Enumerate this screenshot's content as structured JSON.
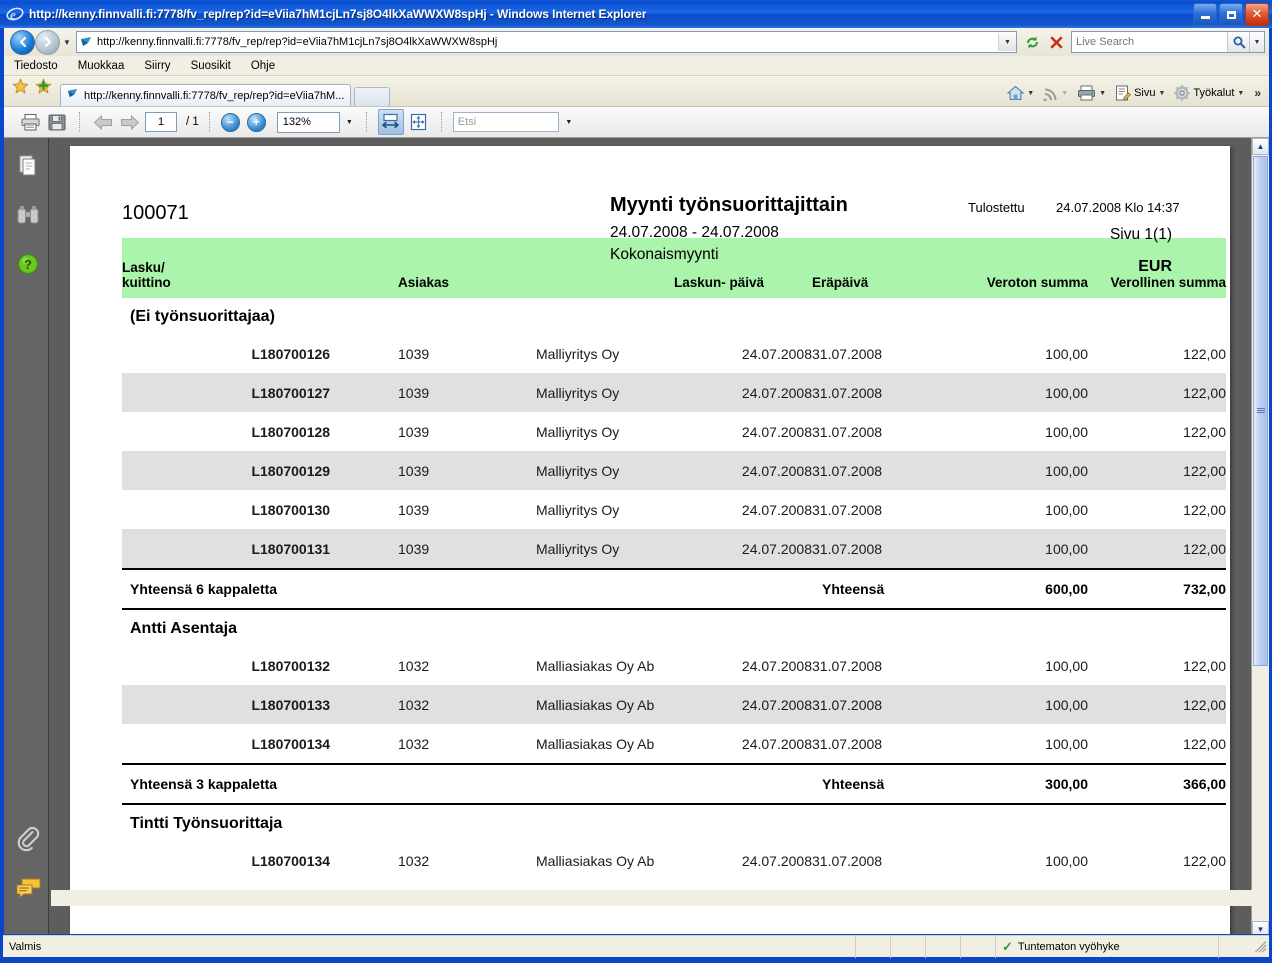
{
  "window": {
    "title": "http://kenny.finnvalli.fi:7778/fv_rep/rep?id=eViia7hM1cjLn7sj8O4lkXaWWXW8spHj - Windows Internet Explorer",
    "minimize_label": "Minimize",
    "maximize_label": "Maximize",
    "close_label": "✕"
  },
  "browser": {
    "address_value": "http://kenny.finnvalli.fi:7778/fv_rep/rep?id=eViia7hM1cjLn7sj8O4lkXaWWXW8spHj",
    "search_placeholder": "Live Search",
    "back_glyph": "◀",
    "forward_glyph": "▶",
    "history_caret": "▼",
    "address_caret": "▼",
    "refresh_glyph": "↻",
    "stop_glyph": "✕",
    "search_go_glyph": "⌕",
    "search_caret": "▼",
    "menu": [
      "Tiedosto",
      "Muokkaa",
      "Siirry",
      "Suosikit",
      "Ohje"
    ],
    "tab_label": "http://kenny.finnvalli.fi:7778/fv_rep/rep?id=eViia7hM...",
    "commands": {
      "home": "Home",
      "feeds": "Feeds",
      "print": "Print",
      "page": "Sivu",
      "tools": "Työkalut",
      "overflow": "»",
      "caret": "▼"
    }
  },
  "pdf_toolbar": {
    "print_label": "Print",
    "save_label": "Save",
    "prev_label": "Previous page",
    "next_label": "Next page",
    "page_value": "1",
    "page_total": "/ 1",
    "zoom_out": "−",
    "zoom_in": "+",
    "zoom_value": "132%",
    "zoom_caret": "▼",
    "fit_width_label": "Fit width",
    "fit_page_label": "Fit page",
    "find_placeholder": "Etsi",
    "find_caret": "▼"
  },
  "sidebar": {
    "icons": [
      {
        "name": "pages-icon",
        "label": "Pages"
      },
      {
        "name": "binoculars-icon",
        "label": "Search"
      },
      {
        "name": "help-icon",
        "label": "Help"
      },
      {
        "name": "attachment-icon",
        "label": "Attachments"
      },
      {
        "name": "comments-icon",
        "label": "Comments"
      }
    ]
  },
  "report": {
    "id": "100071",
    "title": "Myynti työnsuorittajittain",
    "date_range": "24.07.2008 - 24.07.2008",
    "subtitle": "Kokonaismyynti",
    "printed_label": "Tulostettu",
    "printed_value": "24.07.2008 Klo 14:37",
    "page_label": "Sivu 1(1)",
    "currency": "EUR",
    "columns": {
      "invoice_l1": "Lasku/",
      "invoice_l2": "kuittino",
      "customer": "Asiakas",
      "invoice_date_l1": "Laskun-",
      "invoice_date_l2": "päivä",
      "due_date": "Eräpäivä",
      "net_sum": "Veroton summa",
      "gross_sum": "Verollinen summa"
    },
    "groups": [
      {
        "name": "(Ei työnsuorittajaa)",
        "rows": [
          {
            "type": "L",
            "number": "180700126",
            "customer_id": "1039",
            "customer": "Malliyritys Oy",
            "invoice_date": "24.07.2008",
            "due_date": "31.07.2008",
            "net": "100,00",
            "gross": "122,00"
          },
          {
            "type": "L",
            "number": "180700127",
            "customer_id": "1039",
            "customer": "Malliyritys Oy",
            "invoice_date": "24.07.2008",
            "due_date": "31.07.2008",
            "net": "100,00",
            "gross": "122,00"
          },
          {
            "type": "L",
            "number": "180700128",
            "customer_id": "1039",
            "customer": "Malliyritys Oy",
            "invoice_date": "24.07.2008",
            "due_date": "31.07.2008",
            "net": "100,00",
            "gross": "122,00"
          },
          {
            "type": "L",
            "number": "180700129",
            "customer_id": "1039",
            "customer": "Malliyritys Oy",
            "invoice_date": "24.07.2008",
            "due_date": "31.07.2008",
            "net": "100,00",
            "gross": "122,00"
          },
          {
            "type": "L",
            "number": "180700130",
            "customer_id": "1039",
            "customer": "Malliyritys Oy",
            "invoice_date": "24.07.2008",
            "due_date": "31.07.2008",
            "net": "100,00",
            "gross": "122,00"
          },
          {
            "type": "L",
            "number": "180700131",
            "customer_id": "1039",
            "customer": "Malliyritys Oy",
            "invoice_date": "24.07.2008",
            "due_date": "31.07.2008",
            "net": "100,00",
            "gross": "122,00"
          }
        ],
        "total_label": "Yhteensä 6 kappaletta",
        "total_word": "Yhteensä",
        "total_net": "600,00",
        "total_gross": "732,00"
      },
      {
        "name": "Antti Asentaja",
        "rows": [
          {
            "type": "L",
            "number": "180700132",
            "customer_id": "1032",
            "customer": "Malliasiakas Oy Ab",
            "invoice_date": "24.07.2008",
            "due_date": "31.07.2008",
            "net": "100,00",
            "gross": "122,00"
          },
          {
            "type": "L",
            "number": "180700133",
            "customer_id": "1032",
            "customer": "Malliasiakas Oy Ab",
            "invoice_date": "24.07.2008",
            "due_date": "31.07.2008",
            "net": "100,00",
            "gross": "122,00"
          },
          {
            "type": "L",
            "number": "180700134",
            "customer_id": "1032",
            "customer": "Malliasiakas Oy Ab",
            "invoice_date": "24.07.2008",
            "due_date": "31.07.2008",
            "net": "100,00",
            "gross": "122,00"
          }
        ],
        "total_label": "Yhteensä 3 kappaletta",
        "total_word": "Yhteensä",
        "total_net": "300,00",
        "total_gross": "366,00"
      },
      {
        "name": "Tintti Työnsuorittaja",
        "rows": [
          {
            "type": "L",
            "number": "180700134",
            "customer_id": "1032",
            "customer": "Malliasiakas Oy Ab",
            "invoice_date": "24.07.2008",
            "due_date": "31.07.2008",
            "net": "100,00",
            "gross": "122,00"
          }
        ]
      }
    ]
  },
  "statusbar": {
    "ready": "Valmis",
    "zone": "Tuntematon vyöhyke",
    "zone_check": "✓"
  },
  "colors": {
    "header_green": "#aaf5ab",
    "alt_row": "#e0e0e0",
    "title_blue": "#0a46c8"
  }
}
